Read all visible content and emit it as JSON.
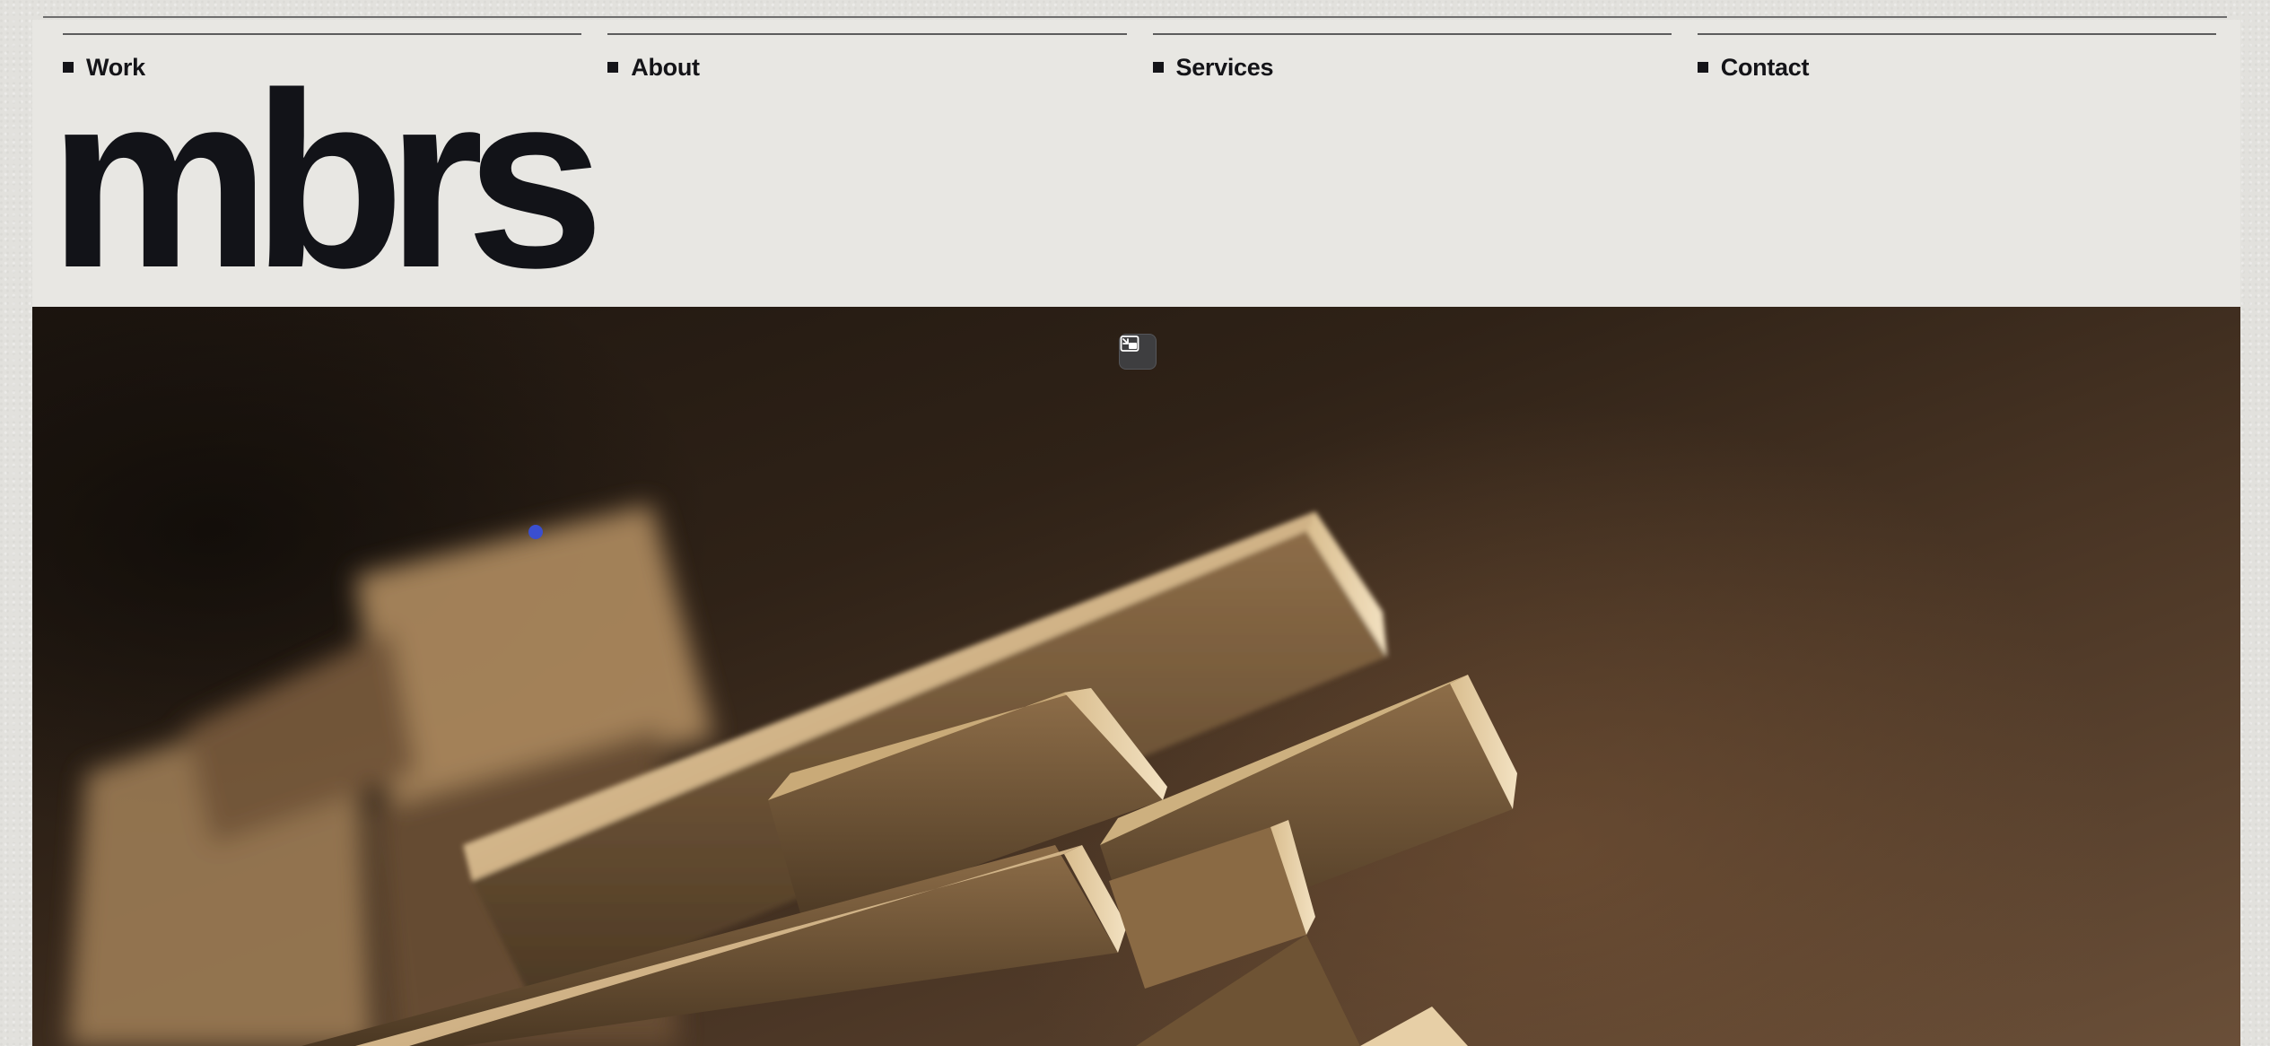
{
  "nav": {
    "items": [
      {
        "label": "Work"
      },
      {
        "label": "About"
      },
      {
        "label": "Services"
      },
      {
        "label": "Contact"
      }
    ]
  },
  "brand": {
    "logo_text": "mbrs"
  },
  "hero": {
    "image": "stacked-wooden-planks-photo",
    "controls": {
      "pip_icon": "picture-in-picture-exit-icon"
    }
  },
  "colors": {
    "page_bg": "#e8e7e3",
    "text": "#141418",
    "hero_dark": "#1e1610",
    "hero_warm": "#6a4f38",
    "cursor": "#3a4fd0"
  }
}
